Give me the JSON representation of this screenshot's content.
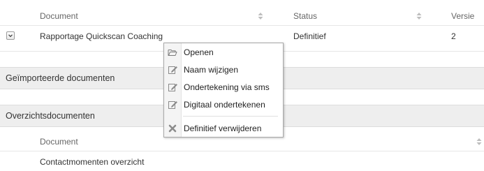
{
  "table": {
    "headers": {
      "document": "Document",
      "status": "Status",
      "version": "Versie"
    },
    "rows": [
      {
        "document": "Rapportage Quickscan Coaching",
        "status": "Definitief",
        "version": "2"
      }
    ]
  },
  "sections": [
    {
      "title": "Geïmporteerde documenten"
    },
    {
      "title": "Overzichtsdocumenten"
    }
  ],
  "overview_table": {
    "header": "Document",
    "rows": [
      {
        "document": "Contactmomenten overzicht"
      }
    ]
  },
  "context_menu": {
    "items": [
      {
        "label": "Openen",
        "icon": "folder-open-icon"
      },
      {
        "label": "Naam wijzigen",
        "icon": "edit-icon"
      },
      {
        "label": "Ondertekening via sms",
        "icon": "edit-icon"
      },
      {
        "label": "Digitaal ondertekenen",
        "icon": "edit-icon"
      },
      {
        "label": "Definitief verwijderen",
        "icon": "delete-x-icon"
      }
    ]
  },
  "colors": {
    "section_background": "#eeeeee",
    "border": "#dddddd",
    "menu_border": "#a9a9a9"
  }
}
